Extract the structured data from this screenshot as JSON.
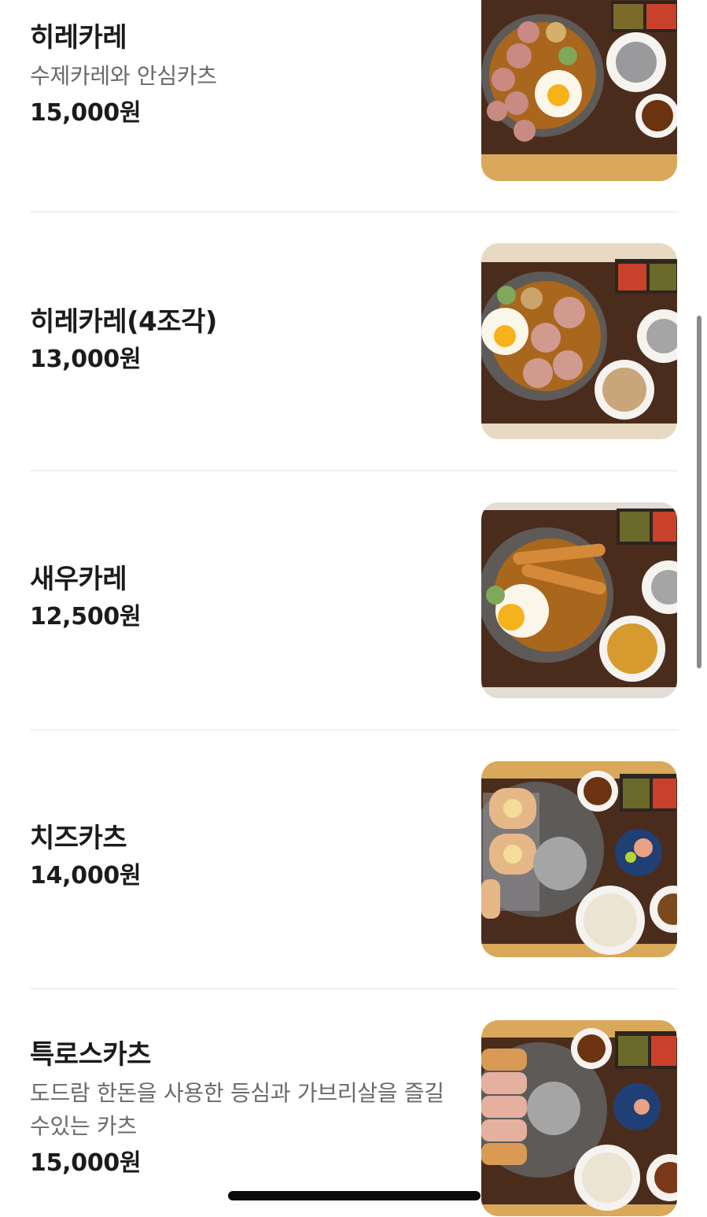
{
  "menu": {
    "items": [
      {
        "name": "히레카레",
        "description": "수제카레와 안심카츠",
        "price": "15,000원",
        "photo_icon": "curry-pork-cutlet-photo"
      },
      {
        "name": "히레카레(4조각)",
        "description": "",
        "price": "13,000원",
        "photo_icon": "curry-pork-cutlet-4pc-photo"
      },
      {
        "name": "새우카레",
        "description": "",
        "price": "12,500원",
        "photo_icon": "shrimp-curry-photo"
      },
      {
        "name": "치즈카츠",
        "description": "",
        "price": "14,000원",
        "photo_icon": "cheese-cutlet-photo"
      },
      {
        "name": "특로스카츠",
        "description": "도드람 한돈을 사용한 등심과 가브리살을 즐길수있는 카츠",
        "price": "15,000원",
        "photo_icon": "special-loin-cutlet-photo"
      }
    ]
  },
  "colors": {
    "text_primary": "#1b1b1b",
    "text_secondary": "#6a6a6a",
    "divider": "#f1f1f1",
    "tray_wood": "#4a2c1d",
    "table_wood": "#d9a85b",
    "curry": "#a9661d",
    "plate_dark": "#5d5a58"
  }
}
